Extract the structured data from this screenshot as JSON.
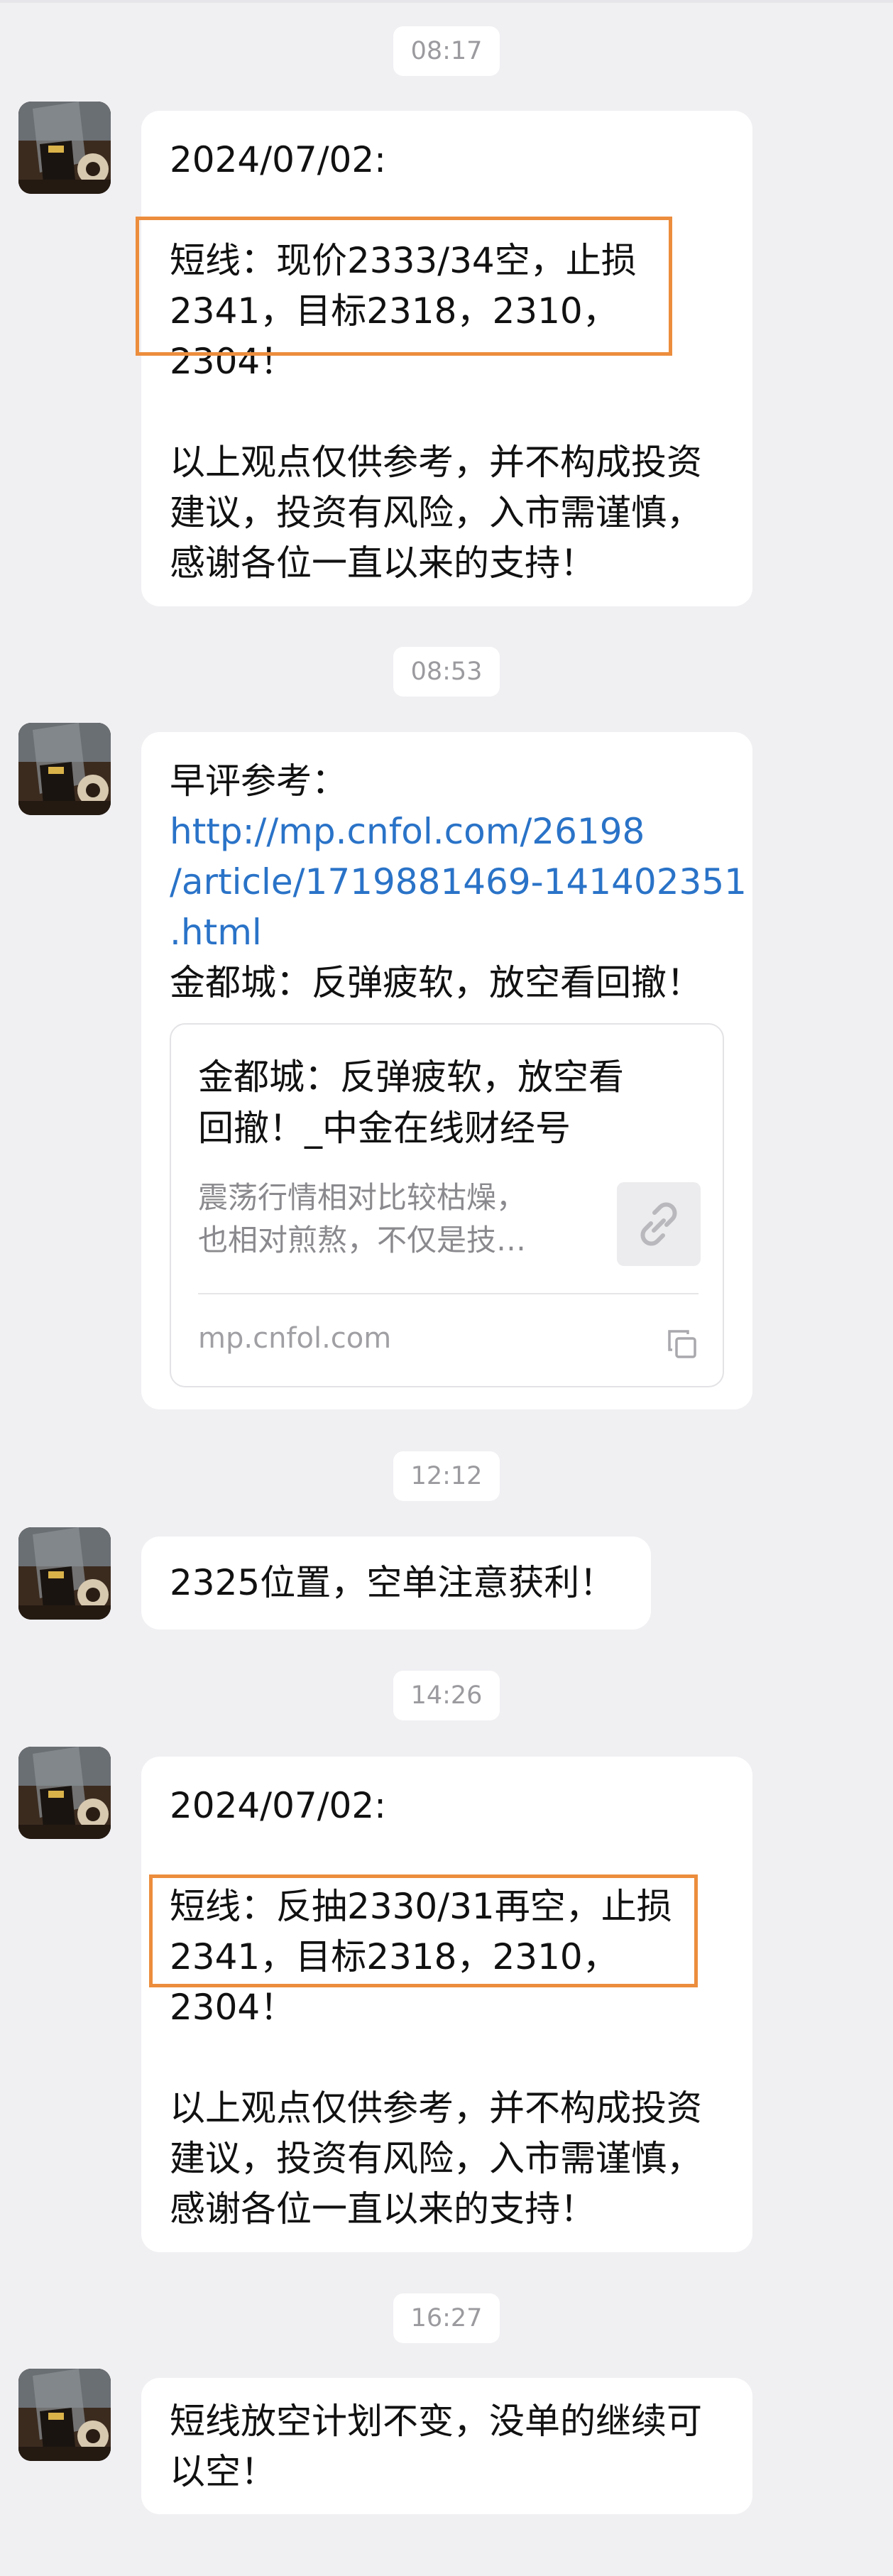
{
  "messages": [
    {
      "time": "08:17",
      "lines": [
        "2024/07/02:",
        "",
        "短线：现价2333/34空，止损",
        "2341，目标2318，2310，",
        "2304！",
        "",
        "以上观点仅供参考，并不构成投资",
        "建议，投资有风险，入市需谨慎，",
        "感谢各位一直以来的支持！"
      ]
    },
    {
      "time": "08:53",
      "lines": [
        "早评参考：",
        "http://mp.cnfol.com/26198",
        "/article/1719881469-141402351",
        ".html",
        "金都城：反弹疲软，放空看回撤！"
      ],
      "link_card": {
        "title_lines": [
          "金都城：反弹疲软，放空看",
          "回撤！_中金在线财经号"
        ],
        "description_lines": [
          "震荡行情相对比较枯燥，",
          "也相对煎熬，不仅是技…"
        ],
        "source": "mp.cnfol.com",
        "thumb_icon": "link-icon",
        "copy_icon": "copy-icon"
      }
    },
    {
      "time": "12:12",
      "lines": [
        "2325位置，空单注意获利！"
      ]
    },
    {
      "time": "14:26",
      "lines": [
        "2024/07/02:",
        "",
        "短线：反抽2330/31再空，止损",
        "2341，目标2318，2310，",
        "2304！",
        "",
        "以上观点仅供参考，并不构成投资",
        "建议，投资有风险，入市需谨慎，",
        "感谢各位一直以来的支持！"
      ]
    },
    {
      "time": "16:27",
      "lines": [
        "短线放空计划不变，没单的继续可",
        "以空！"
      ]
    }
  ],
  "colors": {
    "background": "#f0f0f3",
    "bubble": "#ffffff",
    "link": "#2a73c8",
    "highlight": "#ec8d3d",
    "timestamp_text": "#9b9b9f"
  }
}
